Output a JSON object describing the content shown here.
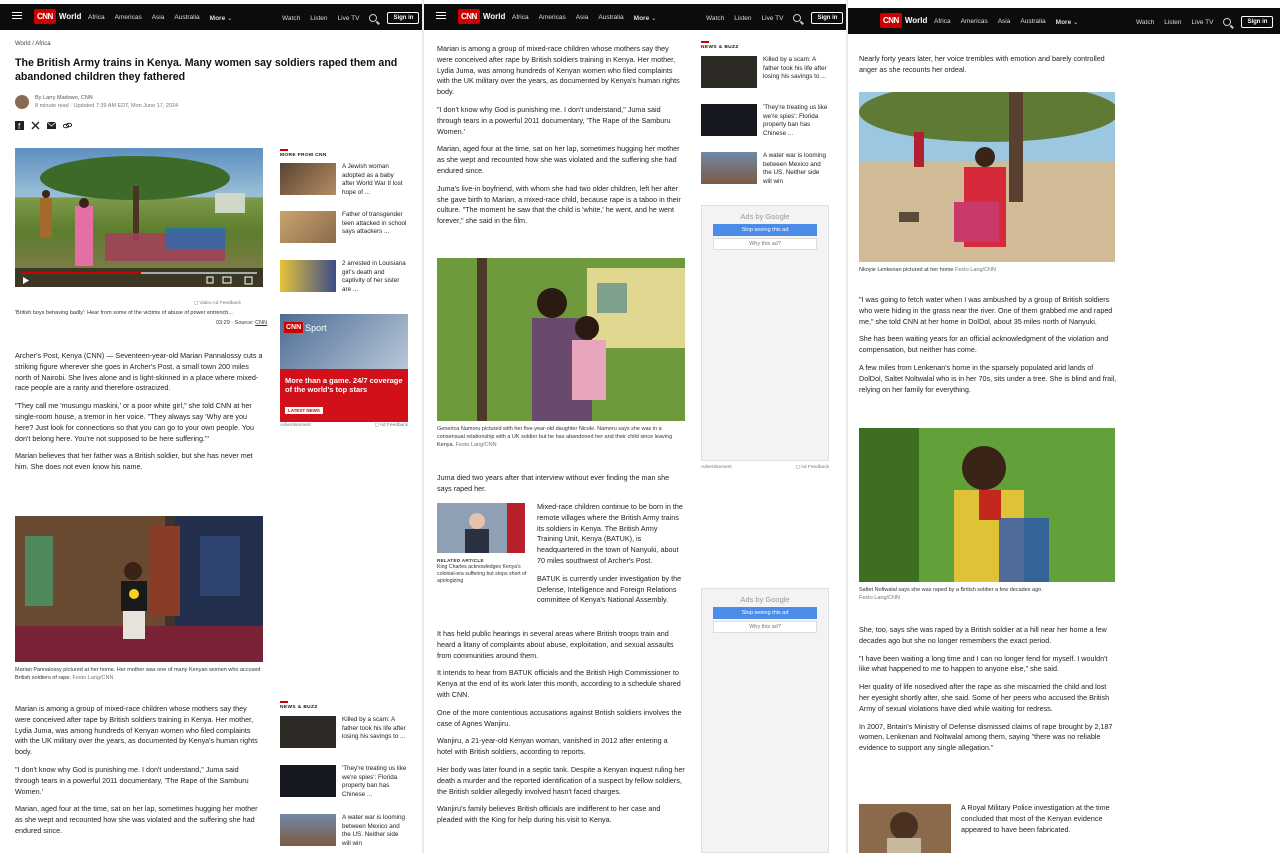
{
  "nav": {
    "logo": "CNN",
    "section": "World",
    "links": [
      "Africa",
      "Americas",
      "Asia",
      "Australia",
      "More"
    ],
    "right_links": [
      "Watch",
      "Listen",
      "Live TV"
    ],
    "signin": "Sign in"
  },
  "article": {
    "breadcrumb": "World / Africa",
    "headline": "The British Army trains in Kenya. Many women say soldiers raped them and abandoned children they fathered",
    "byline": "By Larry Madowo, CNN",
    "meta": "8 minute read · Updated 7:39 AM EDT, Mon June 17, 2024",
    "video_feedback": "Video Ad Feedback",
    "video_caption": "'British boys behaving badly': Hear from some of the victims of abuse of power entrench...",
    "video_time": "03:29 - Source:",
    "video_source": "CNN",
    "p1": [
      "Archer's Post, Kenya (CNN) — Seventeen-year-old Marian Pannalossy cuts a striking figure wherever she goes in Archer's Post, a small town 200 miles north of Nairobi. She lives alone and is light-skinned in a place where mixed-race people are a rarity and therefore ostracized.",
      "\"They call me 'musungu maskini,' or a poor white girl,\" she told CNN at her single-room house, a tremor in her voice. \"They always say 'Why are you here? Just look for connections so that you can go to your own people. You don't belong here. You're not supposed to be here suffering.'\"",
      "Marian believes that her father was a British soldier, but she has never met him. She does not even know his name."
    ],
    "photo1_caption": "Marian Pannalossy pictured at her home. Her mother was one of many Kenyan women who accused British soldiers of rape.",
    "photo1_credit": "Festo Lang/CNN",
    "p2": [
      "Marian is among a group of mixed-race children whose mothers say they were conceived after rape by British soldiers training in Kenya. Her mother, Lydia Juma, was among hundreds of Kenyan women who filed complaints with the UK military over the years, as documented by Kenya's human rights body.",
      "\"I don't know why God is punishing me. I don't understand,\" Juma said through tears in a powerful 2011 documentary, 'The Rape of the Samburu Women.'",
      "Marian, aged four at the time, sat on her lap, sometimes hugging her mother as she wept and recounted how she was violated and the suffering she had endured since.",
      "Juma's live-in boyfriend, with whom she had two older children, left her after she gave birth to Marian, a mixed-race child, because rape is a taboo in their culture. \"The moment he saw that the child is 'white,' he went, and he went forever,\" she said in the film."
    ],
    "photo2_caption": "Generica Namoru pictured with her five-year-old daughter Nicole. Namoru says she was in a consensual relationship with a UK soldier but he has abandoned her and their child since leaving Kenya.",
    "photo2_credit": "Festo Lang/CNN",
    "p3": "Juma died two years after that interview without ever finding the man she says raped her.",
    "related_label": "RELATED ARTICLE",
    "related_text": "King Charles acknowledges Kenya's colonial-era suffering but stops short of apologizing",
    "p4": [
      "Mixed-race children continue to be born in the remote villages where the British Army trains its soldiers in Kenya. The British Army Training Unit, Kenya (BATUK), is headquartered in the town of Nanyuki, about 70 miles southwest of Archer's Post.",
      "BATUK is currently under investigation by the Defense, Intelligence and Foreign Relations committee of Kenya's National Assembly."
    ],
    "p5": [
      "It has held public hearings in several areas where British troops train and heard a litany of complaints about abuse, exploitation, and sexual assaults from communities around them.",
      "It intends to hear from BATUK officials and the British High Commissioner to Kenya at the end of its work later this month, according to a schedule shared with CNN.",
      "One of the more contentious accusations against British soldiers involves the case of Agnes Wanjiru.",
      "Wanjiru, a 21-year-old Kenyan woman, vanished in 2012 after entering a hotel with British soldiers, according to reports.",
      "Her body was later found in a septic tank. Despite a Kenyan inquest ruling her death a murder and the reported identification of a suspect by fellow soldiers, the British soldier allegedly involved hasn't faced charges.",
      "Wanjiru's family believes British officials are indifferent to her case and pleaded with the King for help during his visit to Kenya."
    ],
    "p6": "Nearly forty years later, her voice trembles with emotion and barely controlled anger as she recounts her ordeal.",
    "photo3_caption": "Nkoyie Lenkenan pictured at her home",
    "photo3_credit": "Festo Lang/CNN",
    "p7": [
      "\"I was going to fetch water when I was ambushed by a group of British soldiers who were hiding in the grass near the river. One of them grabbed me and raped me,\" she told CNN at her home in DolDol, about 35 miles north of Nanyuki.",
      "She has been waiting years for an official acknowledgment of the violation and compensation, but neither has come.",
      "A few miles from Lenkenan's home in the sparsely populated arid lands of DolDol, Saltet Noltwalal who is in her 70s, sits under a tree. She is blind and frail, relying on her family for everything."
    ],
    "photo4_caption": "Saltet Noltwalal says she was raped by a British soldier a few decades ago.",
    "photo4_credit": "Festo Lang/CNN",
    "p8": [
      "She, too, says she was raped by a British soldier at a hill near her home a few decades ago but she no longer remembers the exact period.",
      "\"I have been waiting a long time and I can no longer fend for myself. I wouldn't like what happened to me to happen to anyone else,\" she said.",
      "Her quality of life nosedived after the rape as she miscarried the child and lost her eyesight shortly after, she said. Some of her peers who accused the British Army of sexual violations have died while waiting for redress.",
      "In 2007, Britain's Ministry of Defense dismissed claims of rape brought by 2,187 women, Lenkenan and Noltwalal among them, saying \"there was no reliable evidence to support any single allegation.\""
    ],
    "p9": "A Royal Military Police investigation at the time concluded that most of the Kenyan evidence appeared to have been fabricated."
  },
  "sidebar": {
    "more_from": "MORE FROM CNN",
    "more_items": [
      "A Jewish woman adopted as a baby after World War II lost hope of ...",
      "Father of transgender teen attacked in school says attackers ...",
      "2 arrested in Louisiana girl's death and captivity of her sister are ..."
    ],
    "ad_sport": "Sport",
    "ad_text": "More than a game. 24/7 coverage of the world's top stars",
    "ad_button": "LATEST NEWS",
    "ad_label": "Advertisement",
    "ad_feedback": "Ad Feedback",
    "news_buzz": "NEWS & BUZZ",
    "buzz_items": [
      "Killed by a scam: A father took his life after losing his savings to ...",
      "'They're treating us like we're spies': Florida property ban has Chinese ...",
      "A water war is looming between Mexico and the US. Neither side will win"
    ],
    "google_ads": "Ads by Google",
    "google_stop": "Stop seeing this ad",
    "google_why": "Why this ad?"
  },
  "colors": {
    "brand": "#cc0000",
    "nav_bg": "#0c0c0c",
    "google_blue": "#4a8ce8"
  }
}
